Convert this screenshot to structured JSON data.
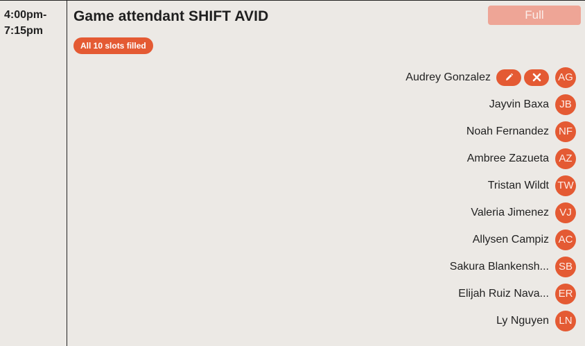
{
  "shift": {
    "time": "4:00pm-\n7:15pm",
    "title": "Game attendant SHIFT AVID",
    "full_label": "Full",
    "badge": "All 10 slots filled"
  },
  "colors": {
    "accent": "#e45a33",
    "full_button": "#eea596",
    "background": "#ece9e5"
  },
  "slots": [
    {
      "name": "Audrey Gonzalez",
      "initials": "AG",
      "edit_icon": "pencil-icon",
      "remove_icon": "close-icon"
    },
    {
      "name": "Jayvin Baxa",
      "initials": "JB"
    },
    {
      "name": "Noah Fernandez",
      "initials": "NF"
    },
    {
      "name": "Ambree Zazueta",
      "initials": "AZ"
    },
    {
      "name": "Tristan Wildt",
      "initials": "TW"
    },
    {
      "name": "Valeria Jimenez",
      "initials": "VJ"
    },
    {
      "name": "Allysen Campiz",
      "initials": "AC"
    },
    {
      "name": "Sakura Blankensh...",
      "initials": "SB"
    },
    {
      "name": "Elijah Ruiz Nava...",
      "initials": "ER"
    },
    {
      "name": "Ly Nguyen",
      "initials": "LN"
    }
  ]
}
